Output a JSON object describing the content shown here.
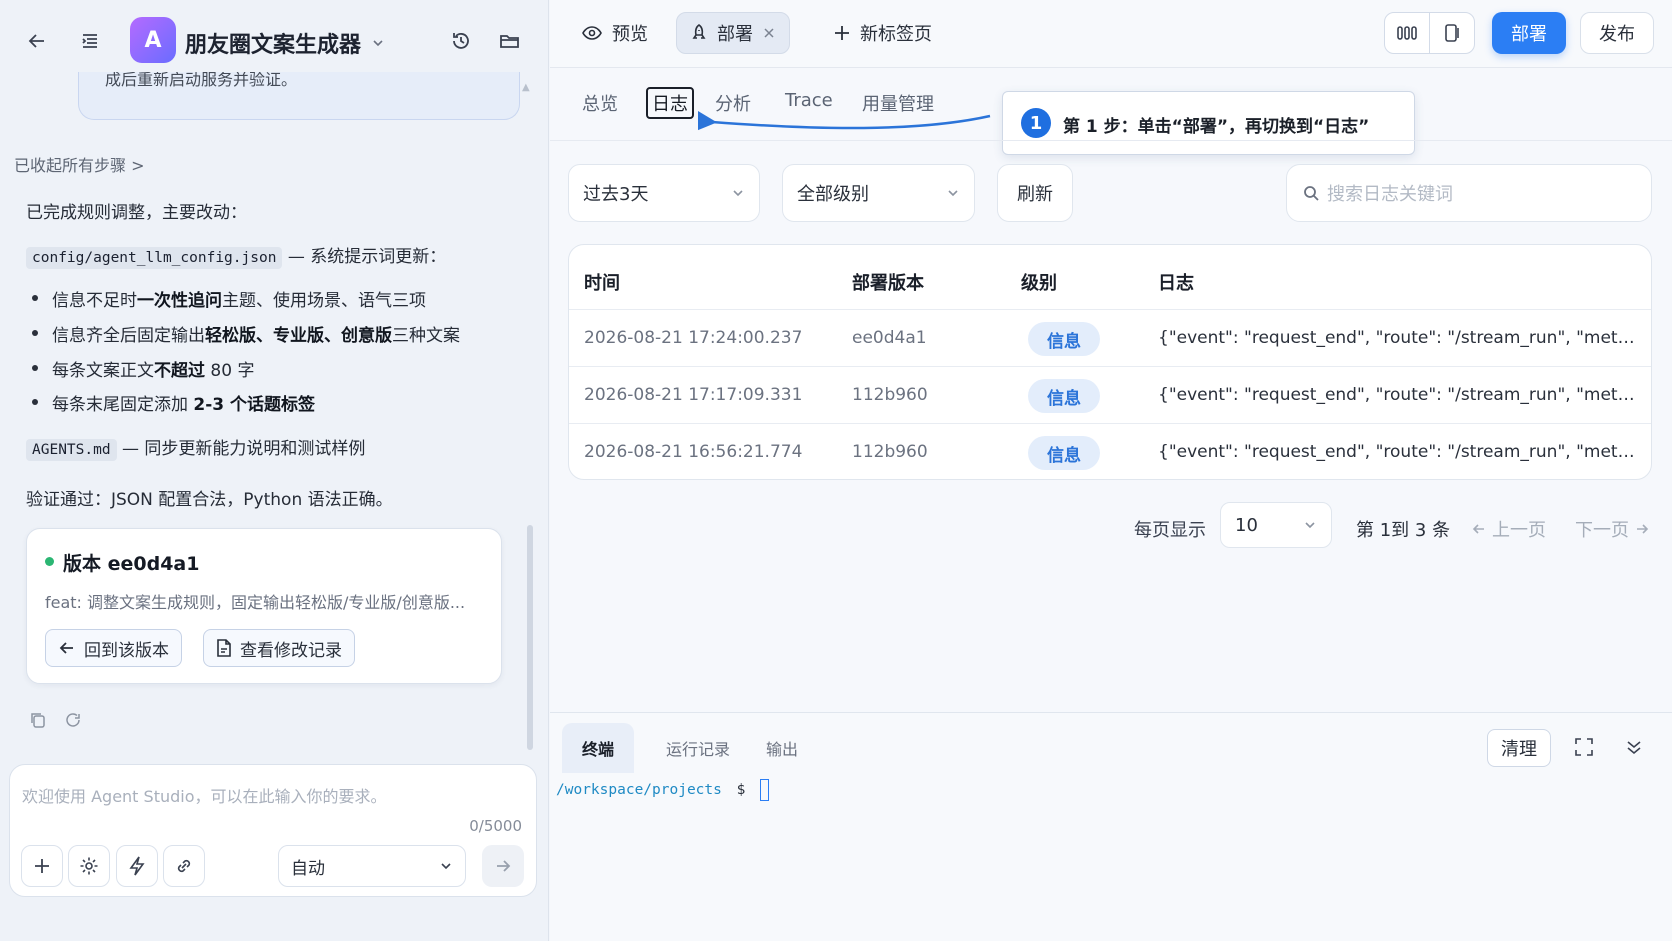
{
  "sidebar": {
    "app_avatar_letter": "A",
    "app_title": "朋友圈文案生成器",
    "prev_message_tail": "成后重新启动服务并验证。",
    "collapsed_label": "已收起所有步骤 >",
    "summary_intro": "已完成规则调整，主要改动：",
    "file1": "config/agent_llm_config.json",
    "file1_note": "— 系统提示词更新：",
    "bullets": [
      {
        "pre": "信息不足时",
        "bold": "一次性追问",
        "post": "主题、使用场景、语气三项"
      },
      {
        "pre": "信息齐全后固定输出",
        "bold": "轻松版、专业版、创意版",
        "post": "三种文案"
      },
      {
        "pre": "每条文案正文",
        "bold": "不超过",
        "post": " 80 字"
      },
      {
        "pre": "每条末尾固定添加 ",
        "bold": "2-3 个话题标签",
        "post": ""
      }
    ],
    "file2": "AGENTS.md",
    "file2_note": "— 同步更新能力说明和测试样例",
    "verify_text": "验证通过：JSON 配置合法，Python 语法正确。",
    "version_card": {
      "title": "版本 ee0d4a1",
      "desc": "feat: 调整文案生成规则，固定输出轻松版/专业版/创意版...",
      "rollback_label": "回到该版本",
      "history_label": "查看修改记录"
    },
    "chat_input": {
      "placeholder": "欢迎使用 Agent Studio，可以在此输入你的要求。",
      "counter": "0/5000",
      "mode": "自动"
    }
  },
  "topbar": {
    "tabs": [
      {
        "label": "预览",
        "icon": "eye-icon"
      },
      {
        "label": "部署",
        "icon": "rocket-icon",
        "active": true
      },
      {
        "label": "新标签页",
        "icon": "plus-icon"
      }
    ],
    "deploy_label": "部署",
    "publish_label": "发布"
  },
  "subtabs": [
    "总览",
    "日志",
    "分析",
    "Trace",
    "用量管理"
  ],
  "callout": {
    "step": "1",
    "text": "第 1 步：单击“部署”，再切换到“日志”"
  },
  "filters": {
    "time_range": "过去3天",
    "level": "全部级别",
    "refresh_label": "刷新",
    "search_placeholder": "搜索日志关键词"
  },
  "log_table": {
    "columns": [
      "时间",
      "部署版本",
      "级别",
      "日志"
    ],
    "rows": [
      {
        "time": "2026-08-21 17:24:00.237",
        "version": "ee0d4a1",
        "level": "信息",
        "log": "{\"event\": \"request_end\", \"route\": \"/stream_run\", \"method\"..."
      },
      {
        "time": "2026-08-21 17:17:09.331",
        "version": "112b960",
        "level": "信息",
        "log": "{\"event\": \"request_end\", \"route\": \"/stream_run\", \"method\"..."
      },
      {
        "time": "2026-08-21 16:56:21.774",
        "version": "112b960",
        "level": "信息",
        "log": "{\"event\": \"request_end\", \"route\": \"/stream_run\", \"method\"..."
      }
    ]
  },
  "pagination": {
    "per_page_label": "每页显示",
    "per_page": "10",
    "info": "第 1到 3 条",
    "prev_label": "上一页",
    "next_label": "下一页"
  },
  "terminal": {
    "tabs": [
      "终端",
      "运行记录",
      "输出"
    ],
    "clear_label": "清理",
    "path": "/workspace/projects",
    "prompt_symbol": "$"
  },
  "colors": {
    "accent": "#2b7ef4",
    "success": "#2bb673",
    "level_badge_bg": "#e3edfb"
  }
}
